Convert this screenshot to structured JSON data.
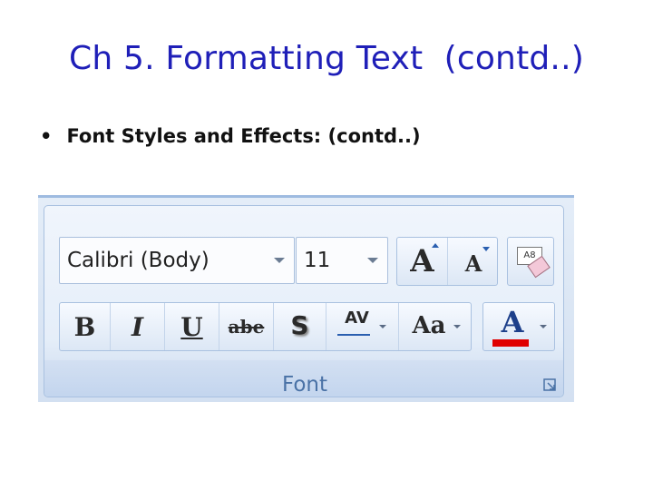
{
  "slide": {
    "title": "Ch 5. Formatting Text  (contd..)",
    "bullet": "Font Styles and Effects: (contd..)"
  },
  "font_group": {
    "label": "Font",
    "font_name": "Calibri (Body)",
    "font_size": "11",
    "grow_font_glyph": "A",
    "shrink_font_glyph": "A",
    "clear_formatting_glyph": "A8",
    "bold_glyph": "B",
    "italic_glyph": "I",
    "underline_glyph": "U",
    "strikethrough_glyph": "abe",
    "shadow_glyph": "S",
    "spacing_glyph": "AV",
    "change_case_glyph": "Aa",
    "font_color_glyph": "A",
    "font_color": "#e00000"
  },
  "colors": {
    "title": "#1f1fb8",
    "ribbon_label": "#4a72a6"
  }
}
